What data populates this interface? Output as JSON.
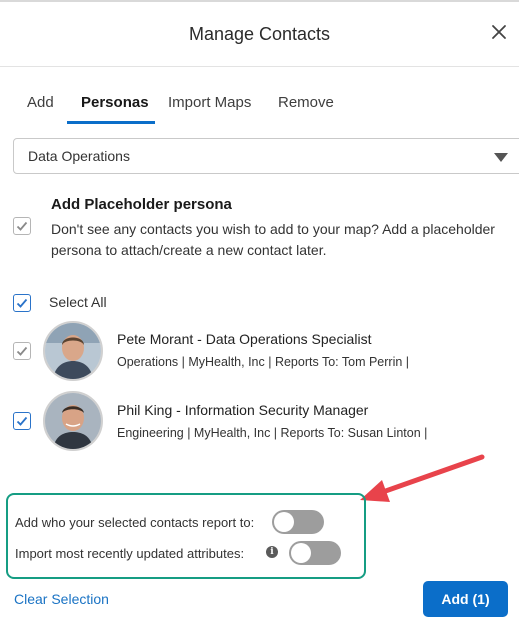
{
  "modal": {
    "title": "Manage Contacts"
  },
  "tabs": [
    {
      "label": "Add",
      "active": false
    },
    {
      "label": "Personas",
      "active": true
    },
    {
      "label": "Import Maps",
      "active": false
    },
    {
      "label": "Remove",
      "active": false
    }
  ],
  "persona_select": {
    "value": "Data Operations"
  },
  "placeholder": {
    "title": "Add Placeholder persona",
    "description": "Don't see any contacts you wish to add to your map? Add a placeholder persona to attach/create a new contact later.",
    "checked": true
  },
  "select_all": {
    "label": "Select All",
    "checked": true
  },
  "contacts": [
    {
      "name": "Pete Morant",
      "title_line": " - Data Operations Specialist",
      "meta": "Operations | MyHealth, Inc | Reports To: Tom Perrin |",
      "checked": true,
      "avatar_icon": "person-photo"
    },
    {
      "name": "Phil King",
      "title_line": " - Information Security Manager",
      "meta": "Engineering | MyHealth, Inc | Reports To: Susan Linton |",
      "checked": true,
      "avatar_icon": "person-photo"
    }
  ],
  "options": {
    "report_to_label": "Add who your selected contacts report to:",
    "report_to_on": false,
    "recent_attrs_label": "Import most recently updated attributes:",
    "recent_attrs_on": false
  },
  "footer": {
    "clear_label": "Clear Selection",
    "add_label": "Add (1)"
  },
  "colors": {
    "accent": "#0b6ec9",
    "annotation_box": "#159d83",
    "annotation_arrow": "#e8434b",
    "toggle_off": "#9d9d9d"
  }
}
